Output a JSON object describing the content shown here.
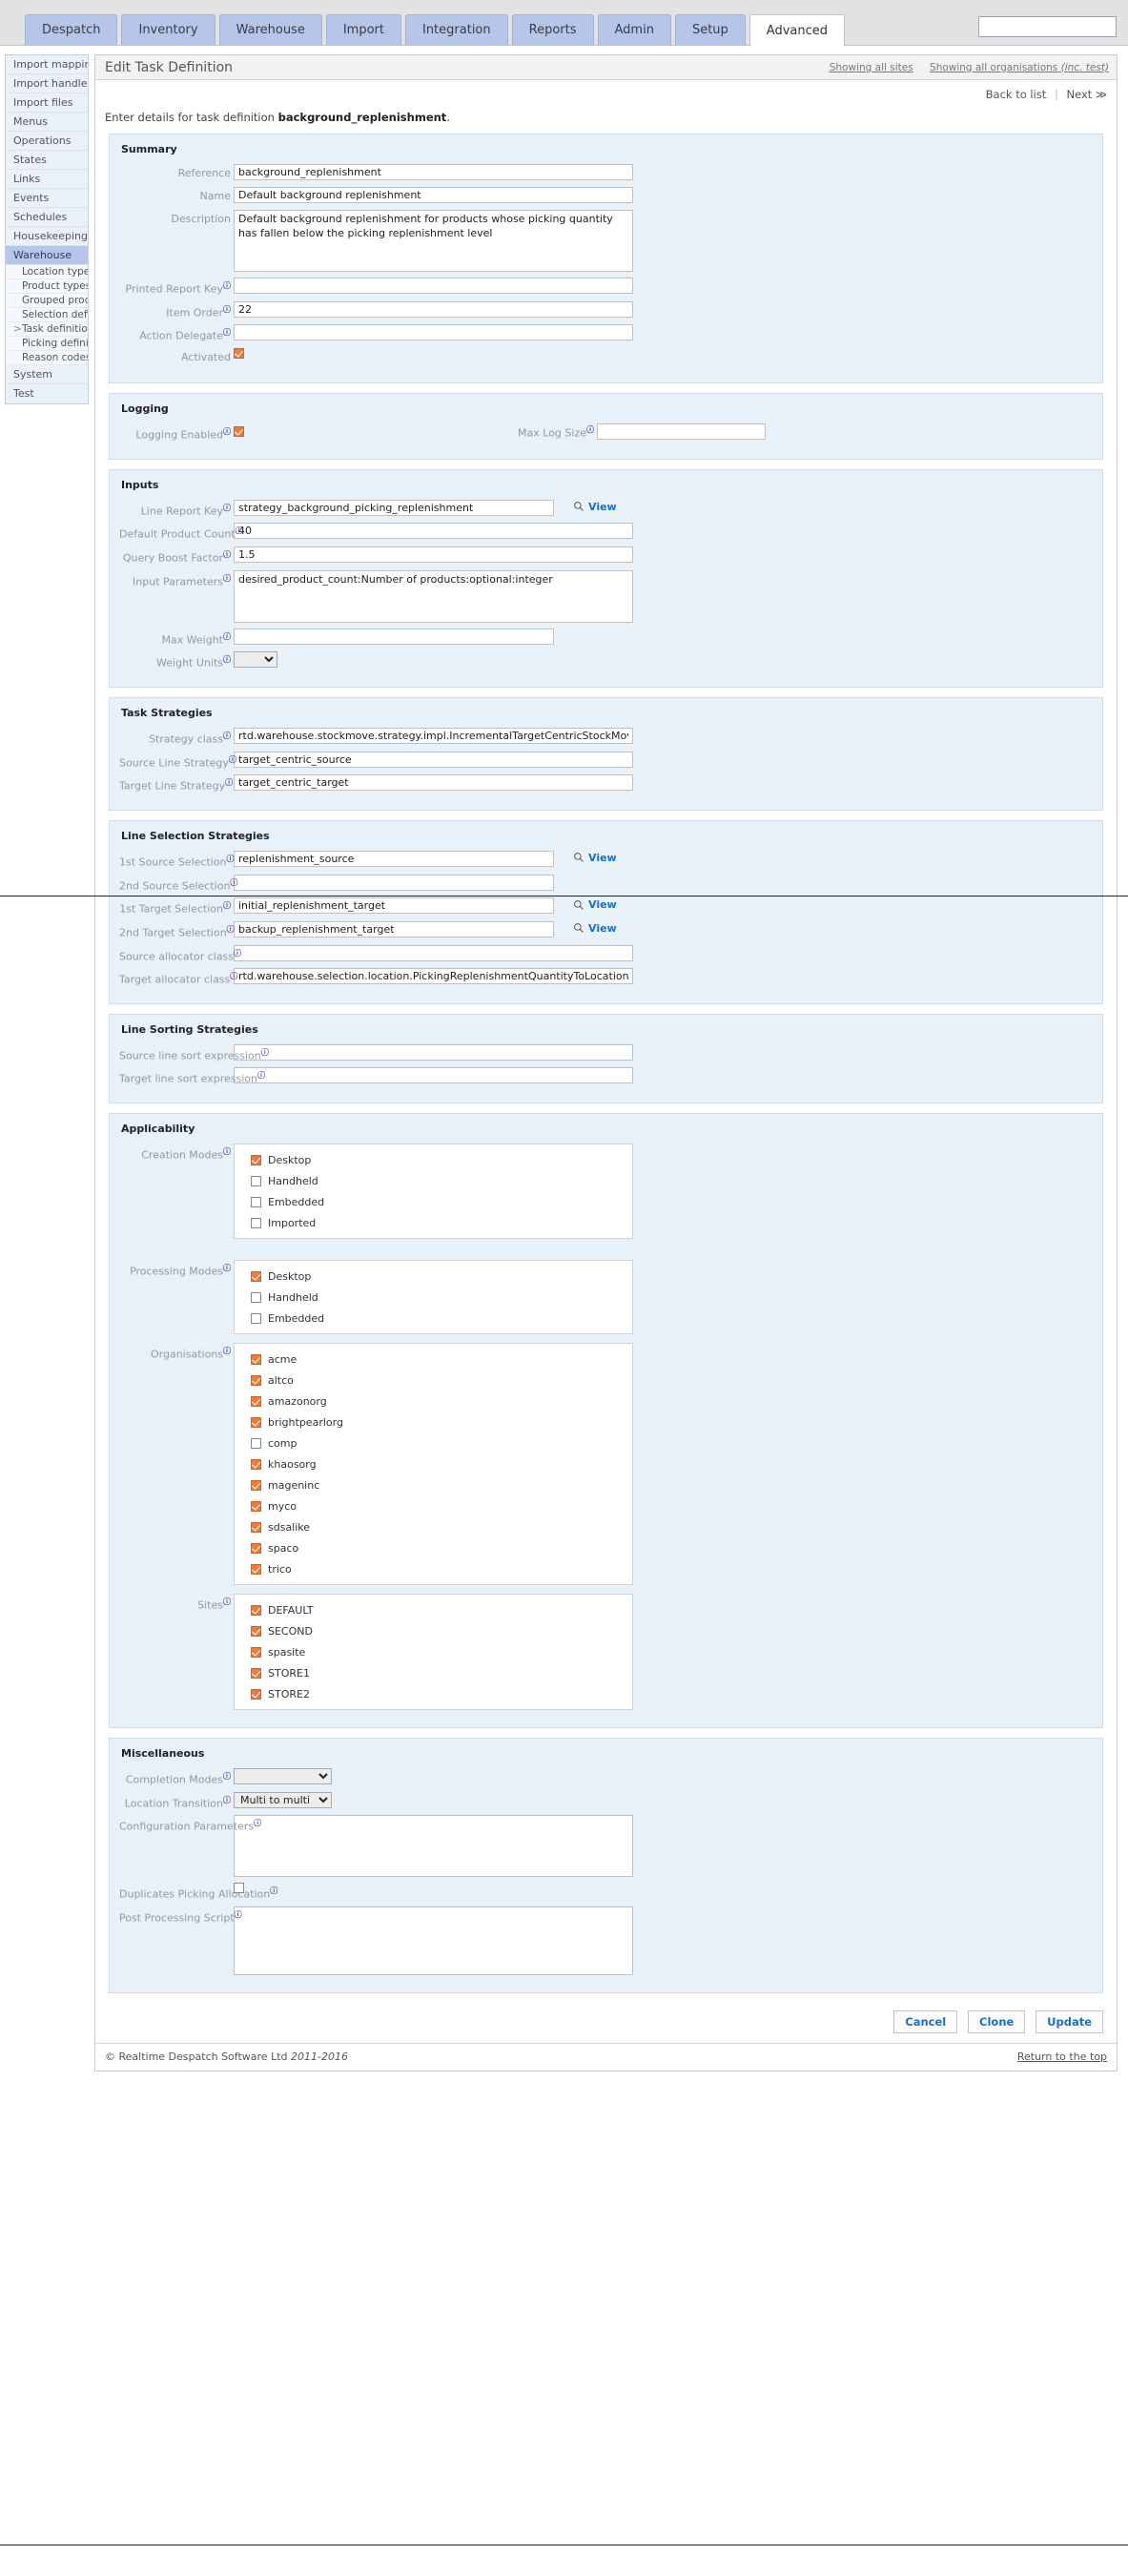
{
  "topbar": {
    "tabs": [
      {
        "label": "Despatch",
        "active": false
      },
      {
        "label": "Inventory",
        "active": false
      },
      {
        "label": "Warehouse",
        "active": false
      },
      {
        "label": "Import",
        "active": false
      },
      {
        "label": "Integration",
        "active": false
      },
      {
        "label": "Reports",
        "active": false
      },
      {
        "label": "Admin",
        "active": false
      },
      {
        "label": "Setup",
        "active": false
      },
      {
        "label": "Advanced",
        "active": true
      }
    ],
    "search": {
      "value": "",
      "placeholder": ""
    }
  },
  "sidebar": {
    "items": [
      {
        "label": "Import mappings",
        "sub": false,
        "selected": false
      },
      {
        "label": "Import handlers",
        "sub": false,
        "selected": false
      },
      {
        "label": "Import files",
        "sub": false,
        "selected": false
      },
      {
        "label": "Menus",
        "sub": false,
        "selected": false
      },
      {
        "label": "Operations",
        "sub": false,
        "selected": false
      },
      {
        "label": "States",
        "sub": false,
        "selected": false
      },
      {
        "label": "Links",
        "sub": false,
        "selected": false
      },
      {
        "label": "Events",
        "sub": false,
        "selected": false
      },
      {
        "label": "Schedules",
        "sub": false,
        "selected": false
      },
      {
        "label": "Housekeeping",
        "sub": false,
        "selected": false
      },
      {
        "label": "Warehouse",
        "sub": false,
        "selected": true
      },
      {
        "label": "Location types",
        "sub": true,
        "selected": false
      },
      {
        "label": "Product types",
        "sub": true,
        "selected": false
      },
      {
        "label": "Grouped products",
        "sub": true,
        "selected": false
      },
      {
        "label": "Selection definitions",
        "sub": true,
        "selected": false
      },
      {
        "label": "Task definitions",
        "sub": true,
        "selected": false,
        "current": true
      },
      {
        "label": "Picking definitions",
        "sub": true,
        "selected": false
      },
      {
        "label": "Reason codes",
        "sub": true,
        "selected": false
      },
      {
        "label": "System",
        "sub": false,
        "selected": false
      },
      {
        "label": "Test",
        "sub": false,
        "selected": false
      }
    ]
  },
  "page": {
    "title": "Edit Task Definition",
    "showing_sites": "Showing all sites",
    "showing_orgs": "Showing all organisations",
    "showing_orgs_note": "(inc. test)",
    "back_to_list": "Back to list",
    "next": "Next ≫",
    "intro_prefix": "Enter details for task definition ",
    "intro_name": "background_replenishment",
    "intro_suffix": "."
  },
  "summary": {
    "title": "Summary",
    "reference_label": "Reference",
    "reference_value": "background_replenishment",
    "name_label": "Name",
    "name_value": "Default background replenishment",
    "description_label": "Description",
    "description_value": "Default background replenishment for products whose picking quantity has fallen below the picking replenishment level",
    "printed_report_key_label": "Printed Report Key",
    "printed_report_key_value": "",
    "item_order_label": "Item Order",
    "item_order_value": "22",
    "action_delegate_label": "Action Delegate",
    "action_delegate_value": "",
    "activated_label": "Activated",
    "activated_checked": true
  },
  "logging": {
    "title": "Logging",
    "logging_enabled_label": "Logging Enabled",
    "logging_enabled_checked": true,
    "max_log_size_label": "Max Log Size",
    "max_log_size_value": ""
  },
  "inputs": {
    "title": "Inputs",
    "line_report_key_label": "Line Report Key",
    "line_report_key_value": "strategy_background_picking_replenishment",
    "view_label": "View",
    "default_product_count_label": "Default Product Count",
    "default_product_count_value": "40",
    "query_boost_factor_label": "Query Boost Factor",
    "query_boost_factor_value": "1.5",
    "input_parameters_label": "Input Parameters",
    "input_parameters_value": "desired_product_count:Number of products:optional:integer",
    "max_weight_label": "Max Weight",
    "max_weight_value": "",
    "weight_units_label": "Weight Units",
    "weight_units_value": ""
  },
  "task_strategies": {
    "title": "Task Strategies",
    "strategy_class_label": "Strategy class",
    "strategy_class_value": "rtd.warehouse.stockmove.strategy.impl.IncrementalTargetCentricStockMoveTypeStrategy",
    "source_line_strategy_label": "Source Line Strategy",
    "source_line_strategy_value": "target_centric_source",
    "target_line_strategy_label": "Target Line Strategy",
    "target_line_strategy_value": "target_centric_target"
  },
  "line_selection": {
    "title": "Line Selection Strategies",
    "view_label": "View",
    "first_source_label": "1st Source Selection",
    "first_source_value": "replenishment_source",
    "second_source_label": "2nd Source Selection",
    "second_source_value": "",
    "first_target_label": "1st Target Selection",
    "first_target_value": "initial_replenishment_target",
    "second_target_label": "2nd Target Selection",
    "second_target_value": "backup_replenishment_target",
    "source_allocator_label": "Source allocator class",
    "source_allocator_value": "",
    "target_allocator_label": "Target allocator class",
    "target_allocator_value": "rtd.warehouse.selection.location.PickingReplenishmentQuantityToLocationAllocator"
  },
  "line_sorting": {
    "title": "Line Sorting Strategies",
    "source_sort_label": "Source line sort expression",
    "source_sort_value": "",
    "target_sort_label": "Target line sort expression",
    "target_sort_value": ""
  },
  "applicability": {
    "title": "Applicability",
    "creation_modes_label": "Creation Modes",
    "creation_modes": [
      {
        "label": "Desktop",
        "checked": true
      },
      {
        "label": "Handheld",
        "checked": false
      },
      {
        "label": "Embedded",
        "checked": false
      },
      {
        "label": "Imported",
        "checked": false
      }
    ],
    "processing_modes_label": "Processing Modes",
    "processing_modes": [
      {
        "label": "Desktop",
        "checked": true
      },
      {
        "label": "Handheld",
        "checked": false
      },
      {
        "label": "Embedded",
        "checked": false
      }
    ],
    "organisations_label": "Organisations",
    "organisations": [
      {
        "label": "acme",
        "checked": true
      },
      {
        "label": "altco",
        "checked": true
      },
      {
        "label": "amazonorg",
        "checked": true
      },
      {
        "label": "brightpearlorg",
        "checked": true
      },
      {
        "label": "comp",
        "checked": false
      },
      {
        "label": "khaosorg",
        "checked": true
      },
      {
        "label": "mageninc",
        "checked": true
      },
      {
        "label": "myco",
        "checked": true
      },
      {
        "label": "sdsalike",
        "checked": true
      },
      {
        "label": "spaco",
        "checked": true
      },
      {
        "label": "trico",
        "checked": true
      }
    ],
    "sites_label": "Sites",
    "sites": [
      {
        "label": "DEFAULT",
        "checked": true
      },
      {
        "label": "SECOND",
        "checked": true
      },
      {
        "label": "spasite",
        "checked": true
      },
      {
        "label": "STORE1",
        "checked": true
      },
      {
        "label": "STORE2",
        "checked": true
      }
    ]
  },
  "miscellaneous": {
    "title": "Miscellaneous",
    "completion_modes_label": "Completion Modes",
    "completion_modes_value": "",
    "location_transition_label": "Location Transition",
    "location_transition_value": "Multi to multi",
    "configuration_parameters_label": "Configuration Parameters",
    "configuration_parameters_value": "",
    "duplicates_picking_label": "Duplicates Picking Allocation",
    "duplicates_picking_checked": false,
    "post_processing_label": "Post Processing Script",
    "post_processing_value": ""
  },
  "actions": {
    "cancel": "Cancel",
    "clone": "Clone",
    "update": "Update"
  },
  "footer": {
    "copyright": "© Realtime Despatch Software Ltd",
    "years": "2011-2016",
    "return_top": "Return to the top"
  },
  "colors": {
    "accent": "#1d6fbf",
    "checkbox_on": "#ee7b3c",
    "tab": "#b6c6e8",
    "panel_bg": "#e8f0f8"
  }
}
